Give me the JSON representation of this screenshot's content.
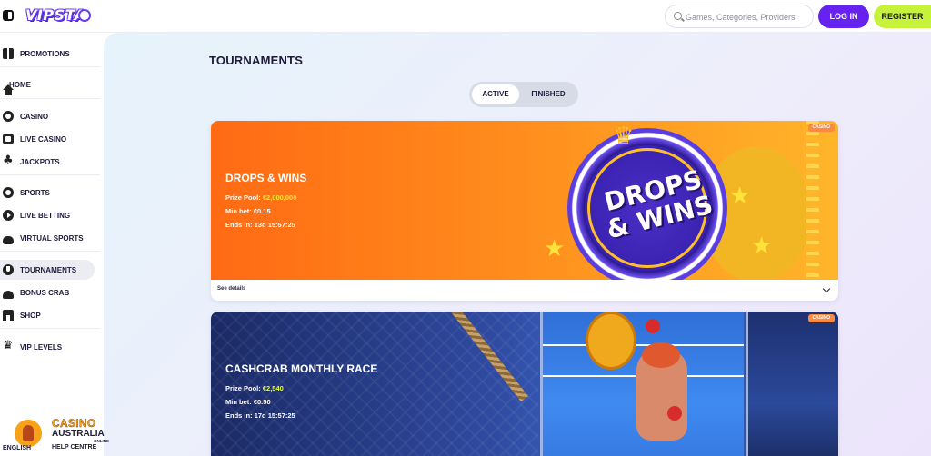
{
  "header": {
    "logo_text": "VIPSTA",
    "search_placeholder": "Games, Categories, Providers",
    "login_label": "LOG IN",
    "register_label": "REGISTER",
    "colors": {
      "login_bg": "#6622ee",
      "register_bg": "#c7f23a"
    }
  },
  "sidebar": {
    "items": [
      {
        "label": "PROMOTIONS",
        "icon": "gift-icon"
      },
      {
        "label": "HOME",
        "icon": "home-icon"
      },
      {
        "label": "CASINO",
        "icon": "casino-icon"
      },
      {
        "label": "LIVE CASINO",
        "icon": "live-casino-icon"
      },
      {
        "label": "JACKPOTS",
        "icon": "clover-icon"
      },
      {
        "label": "SPORTS",
        "icon": "sports-icon"
      },
      {
        "label": "LIVE BETTING",
        "icon": "play-icon"
      },
      {
        "label": "VIRTUAL SPORTS",
        "icon": "gamepad-icon"
      },
      {
        "label": "TOURNAMENTS",
        "icon": "trophy-icon",
        "active": true
      },
      {
        "label": "BONUS CRAB",
        "icon": "crab-icon"
      },
      {
        "label": "SHOP",
        "icon": "shop-icon"
      },
      {
        "label": "VIP LEVELS",
        "icon": "crown-icon"
      }
    ]
  },
  "main": {
    "title": "TOURNAMENTS",
    "tabs": [
      {
        "label": "ACTIVE",
        "selected": true
      },
      {
        "label": "FINISHED",
        "selected": false
      }
    ],
    "tournaments": [
      {
        "category": "CASINO",
        "name": "DROPS & WINS",
        "art_text": "DROPS & WINS",
        "prize_label": "Prize Pool:",
        "prize_value": "€2,000,000",
        "minbet_label": "Min bet:",
        "minbet_value": "€0.15",
        "ends_label": "Ends in:",
        "ends_value": "13d 15:57:25",
        "details_label": "See details"
      },
      {
        "category": "CASINO",
        "name": "CASHCRAB MONTHLY RACE",
        "prize_label": "Prize Pool:",
        "prize_value": "€2,540",
        "minbet_label": "Min bet:",
        "minbet_value": "€0.50",
        "ends_label": "Ends in:",
        "ends_value": "17d 15:57:25"
      }
    ]
  },
  "watermark": {
    "casino": "CASINO",
    "australia": "AUSTRALIA",
    "online": "ONLINE",
    "help_centre": "HELP CENTRE",
    "language": "ENGLISH"
  }
}
